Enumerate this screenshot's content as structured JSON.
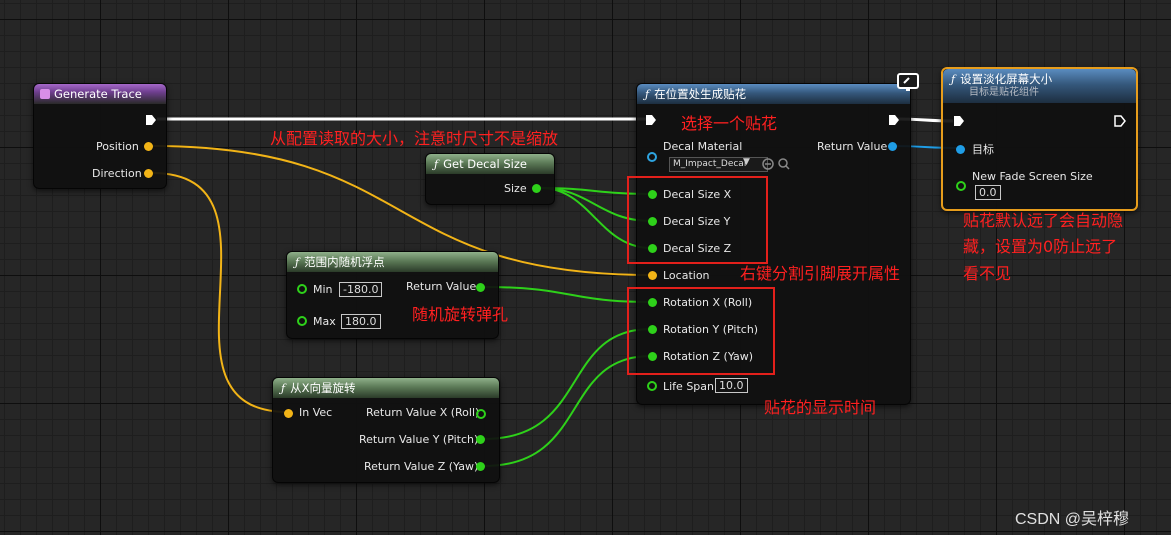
{
  "nodes": {
    "generate_trace": {
      "title": "Generate Trace",
      "pins": {
        "position": "Position",
        "direction": "Direction"
      }
    },
    "spawn_decal": {
      "title": "在位置处生成贴花",
      "pins": {
        "decal_material": "Decal Material",
        "material_value": "M_Impact_Decal",
        "return_value": "Return Value",
        "decal_size_x": "Decal Size X",
        "decal_size_y": "Decal Size Y",
        "decal_size_z": "Decal Size Z",
        "location": "Location",
        "rotation_x": "Rotation X (Roll)",
        "rotation_y": "Rotation Y (Pitch)",
        "rotation_z": "Rotation Z (Yaw)",
        "life_span": "Life Span",
        "life_span_value": "10.0"
      }
    },
    "fade_size": {
      "title": "设置淡化屏幕大小",
      "subtitle": "目标是贴花组件",
      "pins": {
        "target": "目标",
        "new_fade_screen_size": "New Fade Screen Size",
        "new_fade_value": "0.0"
      }
    },
    "get_decal_size": {
      "title": "Get Decal Size",
      "pins": {
        "size": "Size"
      }
    },
    "random_float": {
      "title": "范围内随机浮点",
      "pins": {
        "min": "Min",
        "min_value": "-180.0",
        "max": "Max",
        "max_value": "180.0",
        "return_value": "Return Value"
      }
    },
    "rot_from_x": {
      "title": "从X向量旋转",
      "pins": {
        "in_vec": "In Vec",
        "ret_x": "Return Value X (Roll)",
        "ret_y": "Return Value Y (Pitch)",
        "ret_z": "Return Value Z (Yaw)"
      }
    }
  },
  "annotations": {
    "config_size": "从配置读取的大小，注意时尺寸不是缩放",
    "choose_decal": "选择一个贴花",
    "split_pin": "右键分割引脚展开属性",
    "random_rotate": "随机旋转弹孔",
    "display_time": "贴花的显示时间",
    "fade_note_1": "贴花默认远了会自动隐",
    "fade_note_2": "藏，设置为0防止远了",
    "fade_note_3": "看不见"
  },
  "watermark": "CSDN @吴梓穆",
  "colors": {
    "float_pin": "#2ed11a",
    "vector_pin": "#f2b417",
    "object_pin": "#1f9de6",
    "exec": "#ffffff",
    "annotation": "#ff2020",
    "selection": "#e79d1c"
  },
  "icons": [
    "function-icon",
    "exec-pin-icon",
    "monitor-icon",
    "dropdown-chevron-icon",
    "reset-arrow-icon",
    "browse-search-icon"
  ]
}
